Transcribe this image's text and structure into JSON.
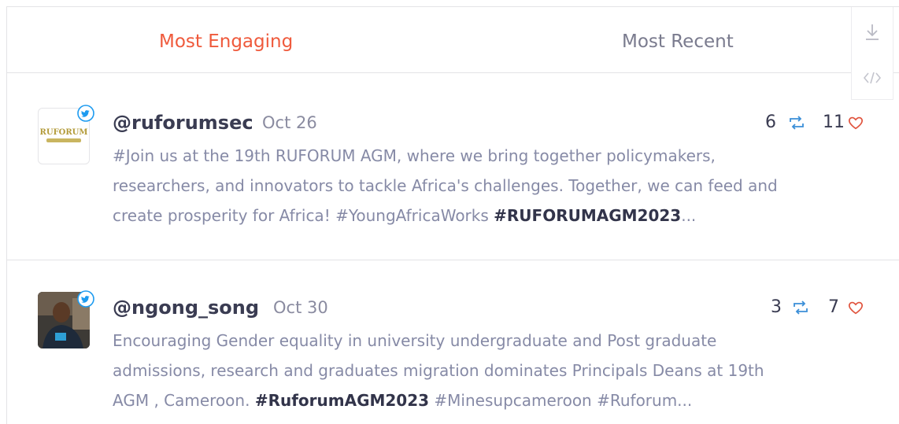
{
  "tabs": {
    "most_engaging": "Most Engaging",
    "most_recent": "Most Recent",
    "active_color": "#ef5a3c"
  },
  "tools": {
    "download_icon": "download-icon",
    "embed_icon": "code-embed-icon"
  },
  "posts": [
    {
      "handle": "@ruforumsec",
      "date": "Oct 26",
      "retweets": "6",
      "likes": "11",
      "avatar_text": "RUFORUM",
      "lines": [
        [
          "#Join us at the 19th RUFORUM AGM, where we bring together policymakers,",
          ""
        ],
        [
          "researchers, and innovators to tackle Africa's challenges. Together, we can feed and",
          ""
        ],
        [
          "create prosperity for Africa! #YoungAfricaWorks ",
          "#RUFORUMAGM2023",
          "..."
        ]
      ]
    },
    {
      "handle": "@ngong_song",
      "date": "Oct 30",
      "retweets": "3",
      "likes": "7",
      "lines": [
        [
          "Encouraging Gender equality in university undergraduate and Post graduate",
          ""
        ],
        [
          "admissions, research and graduates migration dominates Principals Deans at 19th",
          ""
        ],
        [
          "AGM , Cameroon. ",
          "#RuforumAGM2023",
          " #Minesupcameroon #Ruforum..."
        ]
      ]
    }
  ],
  "colors": {
    "twitter_blue": "#1d9bf0",
    "like_red": "#e0533d",
    "retweet_blue": "#3b8fd8"
  }
}
